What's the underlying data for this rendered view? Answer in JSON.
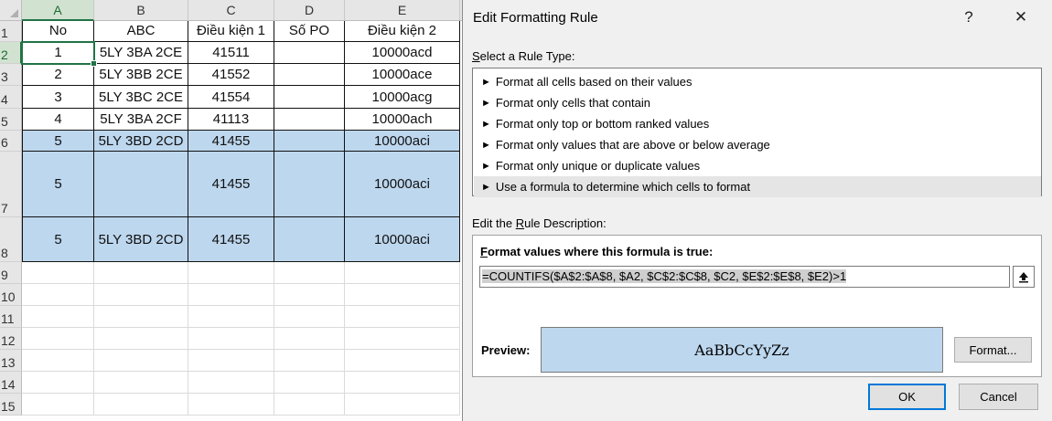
{
  "sheet": {
    "columns": [
      "A",
      "B",
      "C",
      "D",
      "E"
    ],
    "row_numbers": [
      "1",
      "2",
      "3",
      "4",
      "5",
      "6",
      "7",
      "8",
      "9",
      "10",
      "11",
      "12",
      "13",
      "14",
      "15"
    ],
    "header_row": [
      "No",
      "ABC",
      "Điều kiện 1",
      "Số PO",
      "Điều kiện 2"
    ],
    "rows": [
      [
        "1",
        "5LY 3BA 2CE",
        "41511",
        "",
        "10000acd"
      ],
      [
        "2",
        "5LY 3BB 2CE",
        "41552",
        "",
        "10000ace"
      ],
      [
        "3",
        "5LY 3BC 2CE",
        "41554",
        "",
        "10000acg"
      ],
      [
        "4",
        "5LY 3BA 2CF",
        "41113",
        "",
        "10000ach"
      ],
      [
        "5",
        "5LY 3BD 2CD",
        "41455",
        "",
        "10000aci"
      ],
      [
        "5",
        "",
        "41455",
        "",
        "10000aci"
      ],
      [
        "5",
        "5LY 3BD 2CD",
        "41455",
        "",
        "10000aci"
      ]
    ],
    "highlight_color": "#bdd7ee"
  },
  "dialog": {
    "title": "Edit Formatting Rule",
    "help_glyph": "?",
    "close_glyph": "✕",
    "rule_type_label": "Select a Rule Type:",
    "rule_types": [
      "Format all cells based on their values",
      "Format only cells that contain",
      "Format only top or bottom ranked values",
      "Format only values that are above or below average",
      "Format only unique or duplicate values",
      "Use a formula to determine which cells to format"
    ],
    "selected_rule_index": 5,
    "description_label": "Edit the Rule Description:",
    "formula_label": "Format values where this formula is true:",
    "formula_value": "=COUNTIFS($A$2:$A$8, $A2, $C$2:$C$8, $C2, $E$2:$E$8, $E2)>1",
    "preview_label": "Preview:",
    "preview_text": "AaBbCcYyZz",
    "preview_color": "#bdd7ee",
    "format_button": "Format...",
    "ok_button": "OK",
    "cancel_button": "Cancel"
  }
}
